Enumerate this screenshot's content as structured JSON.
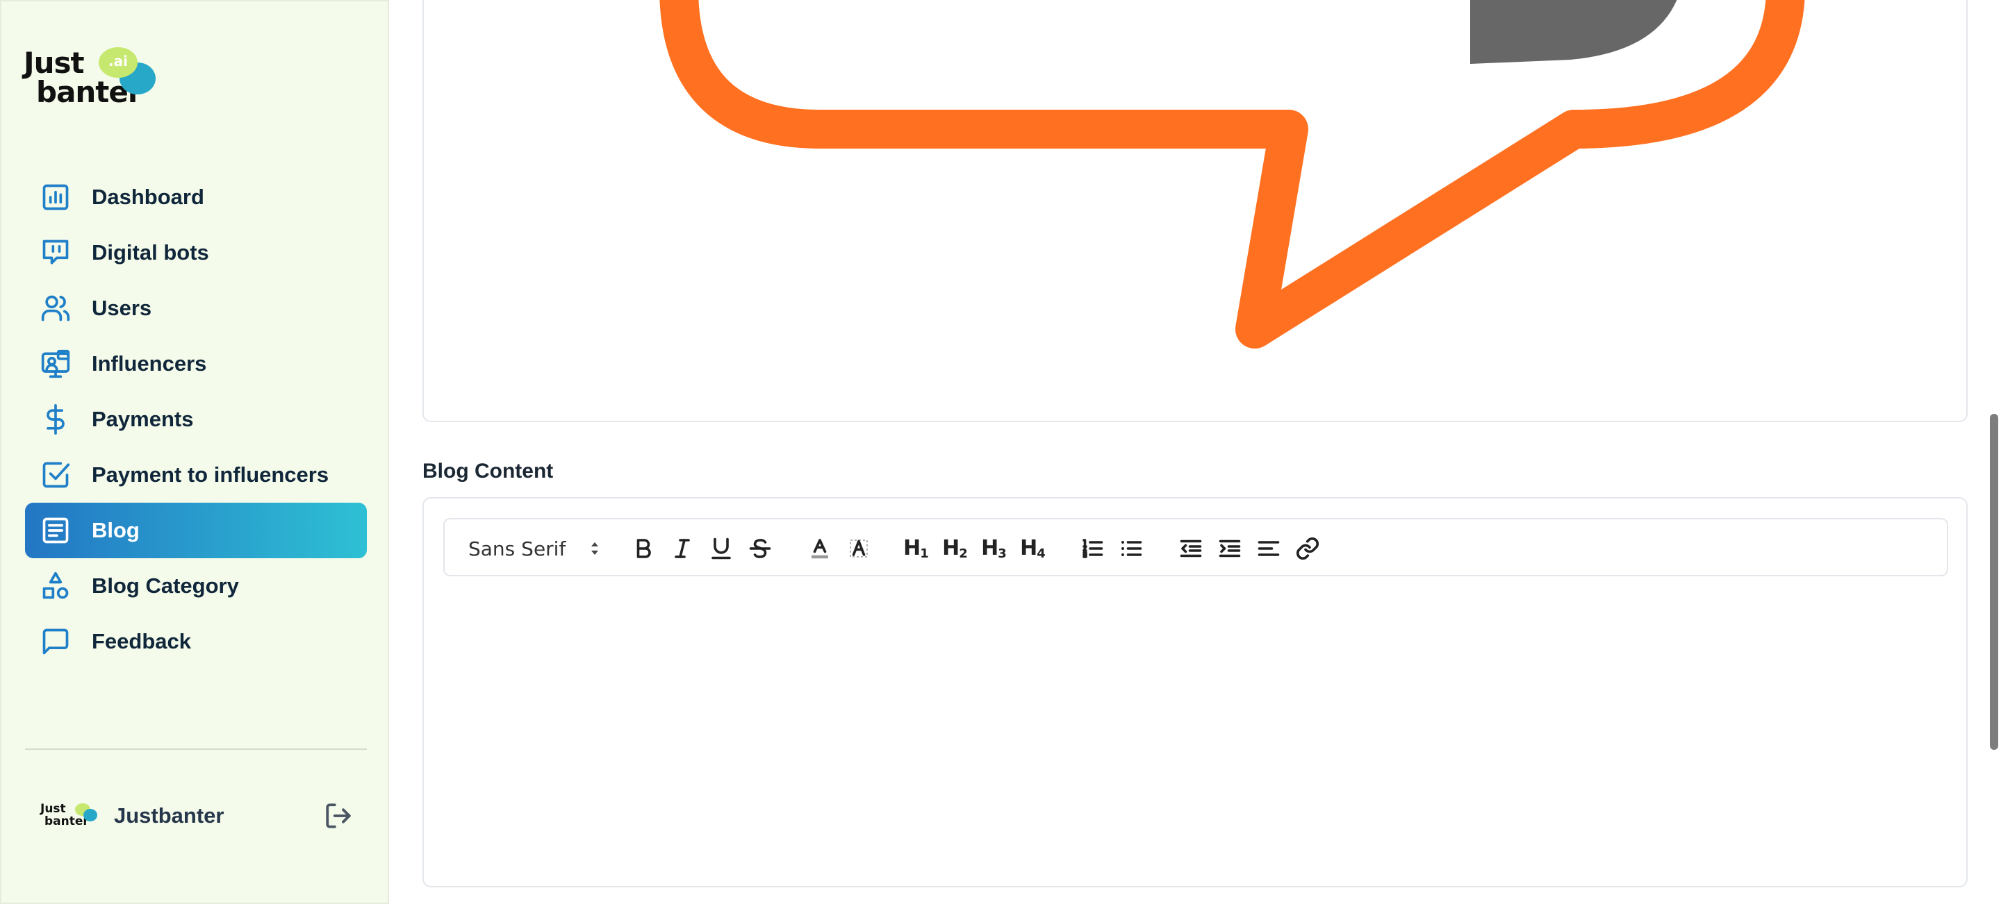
{
  "brand": {
    "logo_line1": "Just",
    "logo_line2": "banter",
    "logo_badge": ".ai"
  },
  "sidebar": {
    "items": [
      {
        "label": "Dashboard",
        "icon": "bar-chart-icon",
        "active": false
      },
      {
        "label": "Digital bots",
        "icon": "chat-bubble-icon",
        "active": false
      },
      {
        "label": "Users",
        "icon": "users-icon",
        "active": false
      },
      {
        "label": "Influencers",
        "icon": "presenter-icon",
        "active": false
      },
      {
        "label": "Payments",
        "icon": "dollar-icon",
        "active": false
      },
      {
        "label": "Payment to influencers",
        "icon": "check-square-icon",
        "active": false
      },
      {
        "label": "Blog",
        "icon": "document-icon",
        "active": true
      },
      {
        "label": "Blog Category",
        "icon": "shapes-icon",
        "active": false
      },
      {
        "label": "Feedback",
        "icon": "message-square-icon",
        "active": false
      }
    ],
    "profile": {
      "name": "Justbanter",
      "avatar_line1": "Just",
      "avatar_line2": "banter"
    }
  },
  "main": {
    "image_preview": {
      "bubble_color": "#ff7020",
      "glyph_color": "#676767"
    },
    "blog_content": {
      "title": "Blog Content",
      "font_family_value": "Sans Serif",
      "toolbar": [
        "bold",
        "italic",
        "underline",
        "strike",
        "text-color",
        "background-color",
        "h1",
        "h2",
        "h3",
        "h4",
        "ordered-list",
        "bullet-list",
        "outdent",
        "indent",
        "align",
        "link"
      ],
      "headings": [
        "H1",
        "H2",
        "H3",
        "H4"
      ],
      "body": ""
    }
  },
  "colors": {
    "sidebar_bg": "#f4fbea",
    "active_gradient_start": "#2376c4",
    "active_gradient_end": "#2ec0d4",
    "icon_color": "#1f7fc8"
  }
}
